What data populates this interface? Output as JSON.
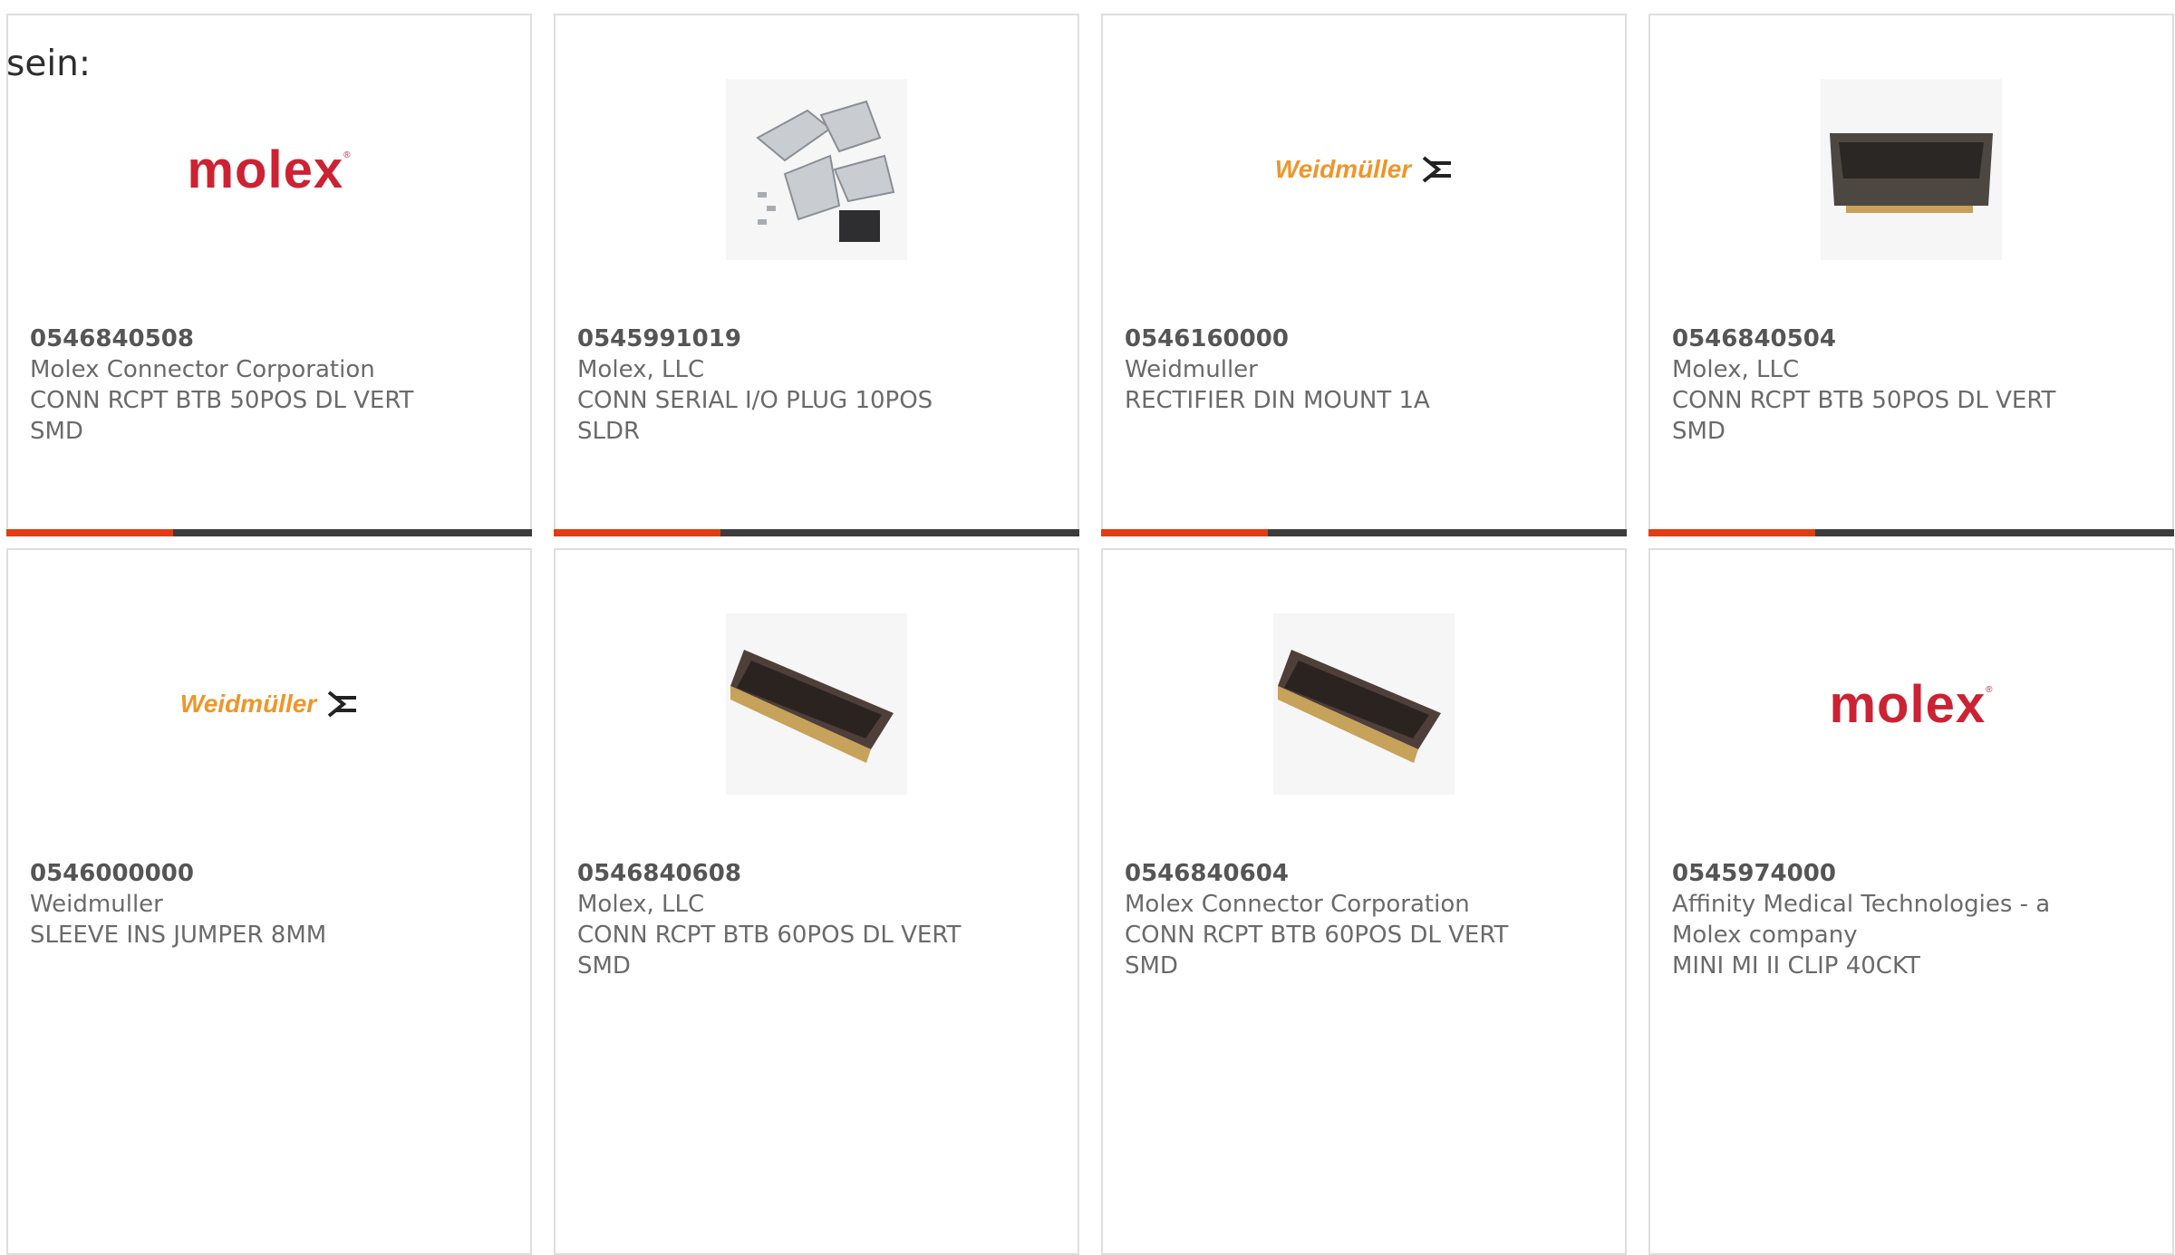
{
  "intro_text": "sein:",
  "products": [
    {
      "part_number": "0546840508",
      "manufacturer": "Molex Connector Corporation",
      "description": "CONN RCPT BTB 50POS DL VERT SMD",
      "image": "molex-logo"
    },
    {
      "part_number": "0545991019",
      "manufacturer": "Molex, LLC",
      "description": "CONN SERIAL I/O PLUG 10POS SLDR",
      "image": "serial-plug-kit-photo"
    },
    {
      "part_number": "0546160000",
      "manufacturer": "Weidmuller",
      "description": "RECTIFIER DIN MOUNT 1A",
      "image": "weidmuller-logo"
    },
    {
      "part_number": "0546840504",
      "manufacturer": "Molex, LLC",
      "description": "CONN RCPT BTB 50POS DL VERT SMD",
      "image": "btb-connector-photo"
    },
    {
      "part_number": "0546000000",
      "manufacturer": "Weidmuller",
      "description": "SLEEVE INS JUMPER 8MM",
      "image": "weidmuller-logo"
    },
    {
      "part_number": "0546840608",
      "manufacturer": "Molex, LLC",
      "description": "CONN RCPT BTB 60POS DL VERT SMD",
      "image": "btb-connector-photo"
    },
    {
      "part_number": "0546840604",
      "manufacturer": "Molex Connector Corporation",
      "description": "CONN RCPT BTB 60POS DL VERT SMD",
      "image": "btb-connector-photo"
    },
    {
      "part_number": "0545974000",
      "manufacturer": "Affinity Medical Technologies - a Molex company",
      "description": "MINI MI II CLIP 40CKT",
      "image": "molex-logo"
    }
  ],
  "logos": {
    "molex": "molex",
    "weidmuller": "Weidmüller"
  },
  "colors": {
    "accent": "#e23d12",
    "bar": "#3c3c3c",
    "molex_red": "#cc2233",
    "weidmuller_orange": "#f0952a"
  }
}
